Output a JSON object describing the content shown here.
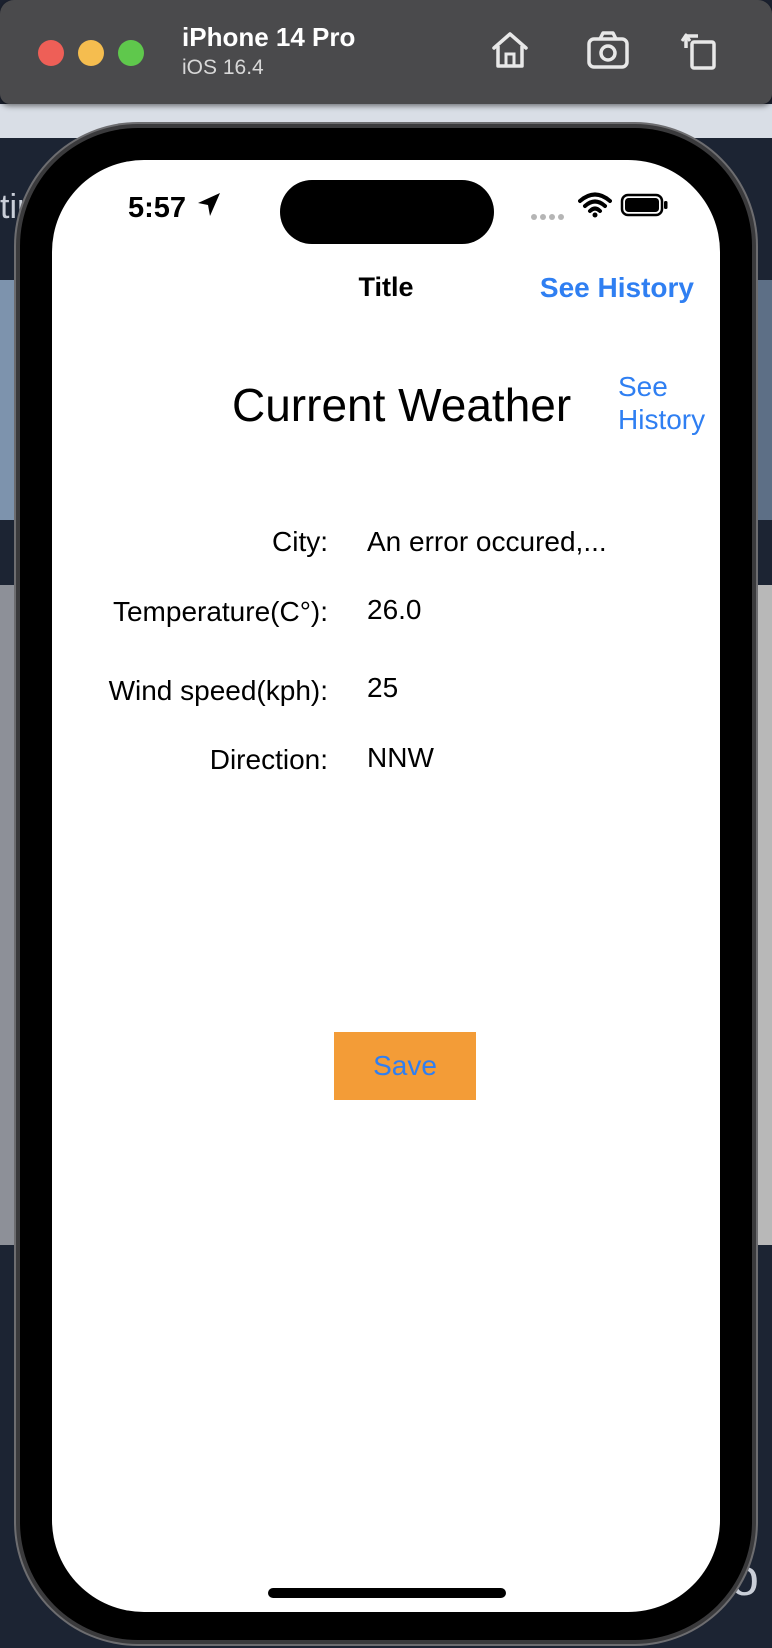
{
  "simulator": {
    "device_name": "iPhone 14 Pro",
    "os_version": "iOS 16.4",
    "toolbar_icons": [
      "home-icon",
      "screenshot-icon",
      "rotate-icon"
    ]
  },
  "status_bar": {
    "time": "5:57",
    "icons": [
      "location-arrow-icon",
      "signal-dots-icon",
      "wifi-icon",
      "battery-icon"
    ]
  },
  "nav_bar": {
    "title": "Title",
    "right_button": "See History"
  },
  "main": {
    "heading": "Current Weather",
    "see_history_link": "See History",
    "rows": [
      {
        "label": "City:",
        "value": "An error occured,..."
      },
      {
        "label": "Temperature(C°):",
        "value": "26.0"
      },
      {
        "label": "Wind speed(kph):",
        "value": "25"
      },
      {
        "label": "Direction:",
        "value": "NNW"
      }
    ],
    "save_button": "Save"
  },
  "colors": {
    "accent_blue": "#2f7ff2",
    "save_orange": "#f39c37"
  }
}
